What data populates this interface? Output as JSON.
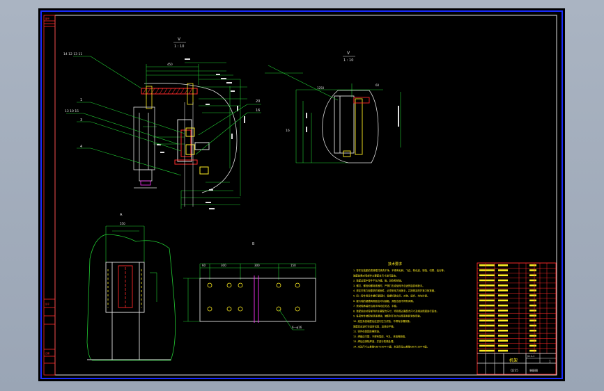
{
  "colors": {
    "frame": "#1a2cff",
    "dim": "#22cc33",
    "outline": "#e0e0e0",
    "text_yellow": "#ffee22",
    "accent_red": "#ff2a2a",
    "magenta": "#ff33ff",
    "background": "#000000"
  },
  "views": {
    "main": {
      "title": "V",
      "scale": "1 : 10"
    },
    "side": {
      "title": "V",
      "scale": "1 : 10"
    }
  },
  "dimensions": {
    "main_top": "450",
    "side_top_left": "1250",
    "side_top_right": "60",
    "detail_width": "550",
    "plate_segments": [
      "60",
      "300",
      "300",
      "150"
    ]
  },
  "callouts": {
    "top_left": "14 12 13 11",
    "item_1": "1",
    "item_2": "13 10 15",
    "item_3": "3",
    "item_4": "4",
    "right_a": "20",
    "right_b": "16",
    "side_label": "16",
    "plate_hole": "6—φ16"
  },
  "notes": {
    "title": "技术要求",
    "lines": [
      "1. 零件在装配前须清理并清洗干净，不得有毛刺、飞边、氧化皮、锈蚀、切屑、油污等；",
      "   装配前需对零部件主要配合尺寸进行复查。",
      "2. 装配过程中零件不允许磕、碰、划伤和锈蚀。",
      "3. 螺钉、螺栓和螺母紧固时，严禁打击或使用不合适的旋具和扳手。",
      "4. 规定拧紧力矩要求的紧固件，必须采用力矩扳手，并按规定的拧紧力矩紧固。",
      "5. 同一零件用多件螺钉紧固时，各螺钉需交叉、对称、逐步、均匀拧紧。",
      "6. 键与轴的键槽两侧面应均匀接触，其配合面不得有间隙。",
      "7. 滚动轴承装好后用手转动应灵活、平稳。",
      "8. 装配前应对零部件的主要配合尺寸，特别是过盈配合尺寸及相关精度进行复查。",
      "9. 各密封件装配前须浸透油，装配时不允许出现歪斜和划伤现象。",
      "10. 液压系统装配后应进行压力试验，不得有渗漏现象。",
      "   装配后应进行空运转试验，运转应平稳。",
      "11. 零件在装配前需除油。",
      "12. 焊缝应平整，不得有裂纹、气孔、夹渣等缺陷。",
      "13. 焊后应清除焊渣，并进行防锈处理。",
      "14. 未注尺寸公差按GB/T1804-m级，未注形位公差按GB/T1184-K级。"
    ]
  },
  "title_block": {
    "name": "机架",
    "code": "JX-1-1",
    "material_label": "Q235",
    "sheet": "1",
    "company": "装配图",
    "rows": 18
  },
  "frame_left": {
    "top": "图号",
    "mid": "签字",
    "bottom": "日期"
  }
}
